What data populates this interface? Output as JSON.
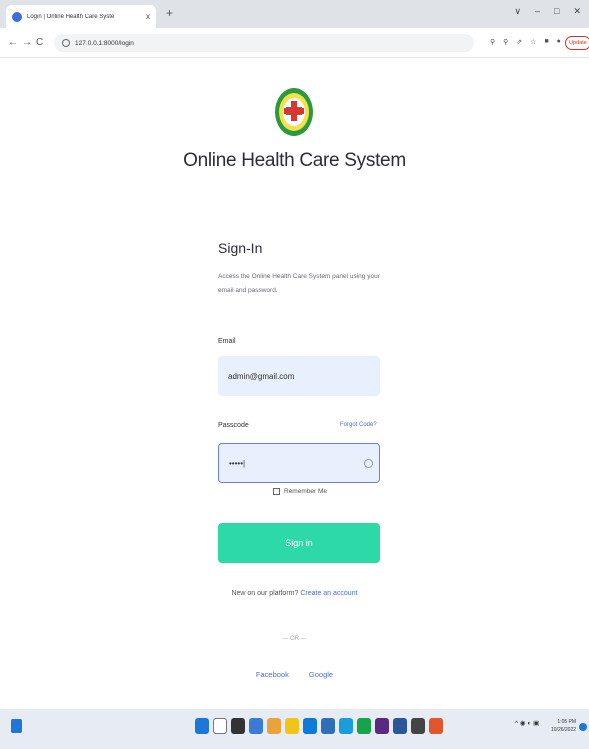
{
  "browser": {
    "tab_title": "Login | Online Health Care Syste",
    "tab_close": "x",
    "new_tab": "+",
    "url": "127.0.0.1:8000/login",
    "update_label": "Update",
    "nav_back": "←",
    "nav_forward": "→",
    "nav_reload": "C"
  },
  "page": {
    "app_title": "Online Health Care System",
    "heading": "Sign-In",
    "description": "Access the Online Health Care System panel using your email and password.",
    "email_label": "Email",
    "email_value": "admin@gmail.com",
    "passcode_label": "Passcode",
    "forgot_label": "Forgot Code?",
    "passcode_value": "•••••|",
    "remember_label": "Remember Me",
    "signin_label": "Sign in",
    "new_text": "New on our platform?",
    "create_link": "Create an account",
    "or_text": "— OR —",
    "social_facebook": "Facebook",
    "social_google": "Google"
  },
  "taskbar": {
    "time": "1:05 PM",
    "date": "10/26/2022",
    "tray": "^ ◉ ◐ ▣"
  },
  "colors": {
    "accent": "#2dd9a6",
    "link": "#4b6fd1",
    "field_bg": "#e8f0fe"
  }
}
